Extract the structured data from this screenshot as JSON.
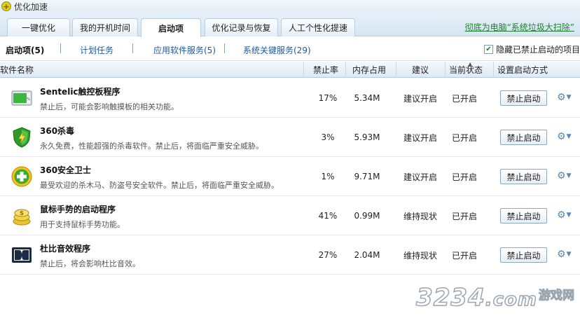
{
  "window": {
    "title": "优化加速"
  },
  "tabs": [
    {
      "label": "一键优化",
      "active": false
    },
    {
      "label": "我的开机时间",
      "active": false
    },
    {
      "label": "启动项",
      "active": true
    },
    {
      "label": "优化记录与恢复",
      "active": false
    },
    {
      "label": "人工个性化提速",
      "active": false
    }
  ],
  "promo_link": "彻底为电脑“系统垃圾大扫除”",
  "subnav": {
    "items": [
      {
        "label": "启动项(5)",
        "active": true
      },
      {
        "label": "计划任务",
        "active": false
      },
      {
        "label": "应用软件服务(5)",
        "active": false
      },
      {
        "label": "系统关键服务(29)",
        "active": false
      }
    ],
    "hide_disabled": {
      "label": "隐藏已禁止启动的项目",
      "checked": true
    }
  },
  "table": {
    "headers": {
      "name": "软件名称",
      "ban_rate": "禁止率",
      "memory": "内存占用",
      "advice": "建议",
      "status": "当前状态",
      "setting": "设置启动方式"
    },
    "rows": [
      {
        "name": "Sentelic触控板程序",
        "desc": "禁止后，可能会影响触摸板的相关功能。",
        "icon": "touchpad-icon",
        "ban_rate": "17%",
        "memory": "5.34M",
        "advice": "建议开启",
        "status": "已开启",
        "action": "禁止启动"
      },
      {
        "name": "360杀毒",
        "desc": "永久免费，性能超强的杀毒软件。禁止后，将面临严重安全威胁。",
        "icon": "antivirus-shield-icon",
        "ban_rate": "3%",
        "memory": "5.93M",
        "advice": "建议开启",
        "status": "已开启",
        "action": "禁止启动"
      },
      {
        "name": "360安全卫士",
        "desc": "最受欢迎的杀木马、防盗号安全软件。禁止后，将面临严重安全威胁。",
        "icon": "security-guard-icon",
        "ban_rate": "1%",
        "memory": "9.71M",
        "advice": "建议开启",
        "status": "已开启",
        "action": "禁止启动"
      },
      {
        "name": "鼠标手势的启动程序",
        "desc": "用于支持鼠标手势功能。",
        "icon": "mouse-gesture-icon",
        "ban_rate": "41%",
        "memory": "0.99M",
        "advice": "维持现状",
        "status": "已开启",
        "action": "禁止启动"
      },
      {
        "name": "杜比音效程序",
        "desc": "禁止后，将会影响杜比音效。",
        "icon": "dolby-icon",
        "ban_rate": "27%",
        "memory": "2.04M",
        "advice": "维持现状",
        "status": "已开启",
        "action": "禁止启动"
      }
    ]
  },
  "watermark": {
    "number": "3234",
    "suffix": ".com",
    "site": "游戏网"
  },
  "colors": {
    "accent_link": "#1b5aa5",
    "promo_green": "#1f7f2f",
    "header_bg": "#dce9f5"
  }
}
